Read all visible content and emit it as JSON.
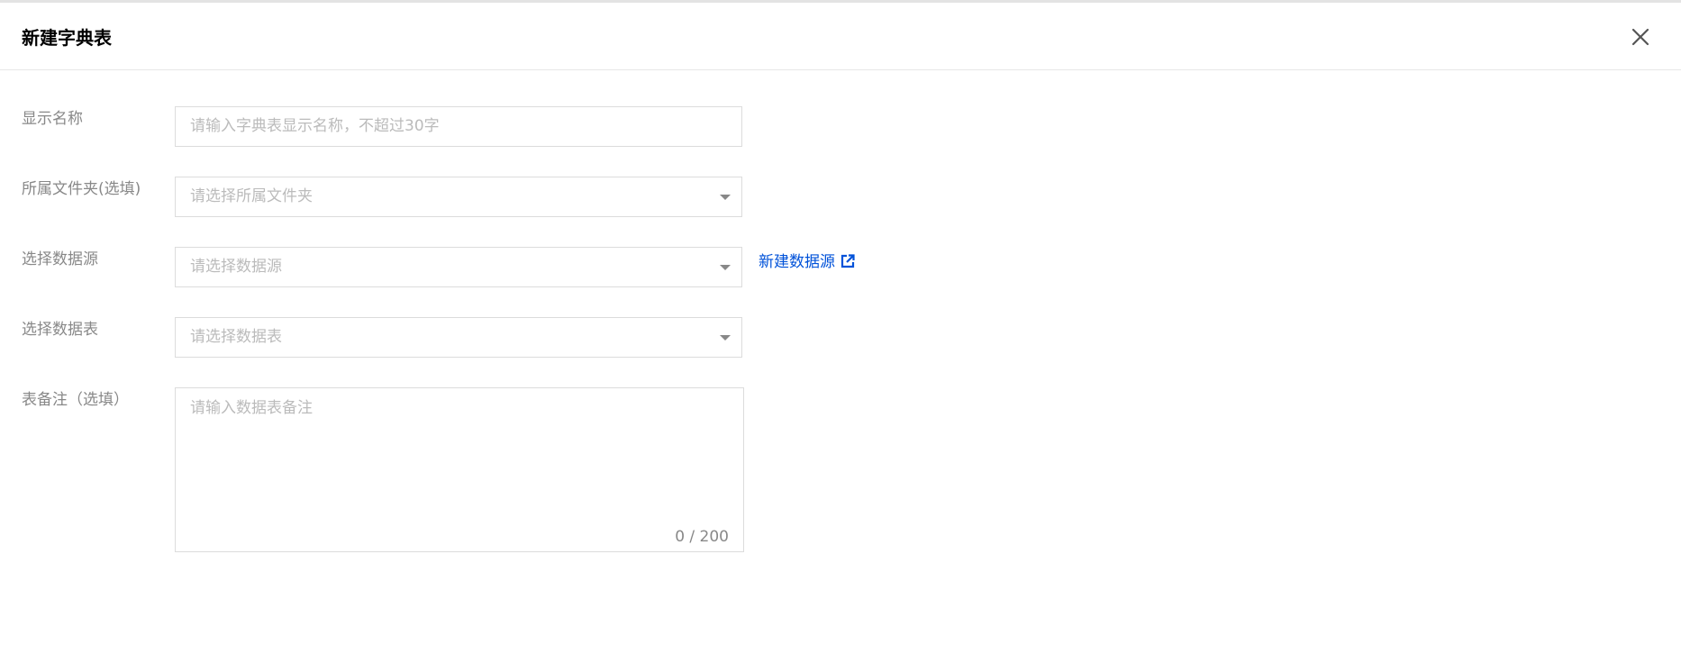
{
  "dialog": {
    "title": "新建字典表",
    "close_icon": "close-icon"
  },
  "form": {
    "display_name": {
      "label": "显示名称",
      "placeholder": "请输入字典表显示名称，不超过30字"
    },
    "folder": {
      "label": "所属文件夹(选填)",
      "placeholder": "请选择所属文件夹"
    },
    "datasource": {
      "label": "选择数据源",
      "placeholder": "请选择数据源",
      "new_link": "新建数据源",
      "link_icon": "external-link-icon"
    },
    "datatable": {
      "label": "选择数据表",
      "placeholder": "请选择数据表"
    },
    "remark": {
      "label": "表备注（选填）",
      "placeholder": "请输入数据表备注",
      "counter": "0 / 200"
    }
  },
  "colors": {
    "link": "#0052d9",
    "label": "#888888",
    "placeholder": "#bbbbbb",
    "border": "#dcdcdc"
  }
}
